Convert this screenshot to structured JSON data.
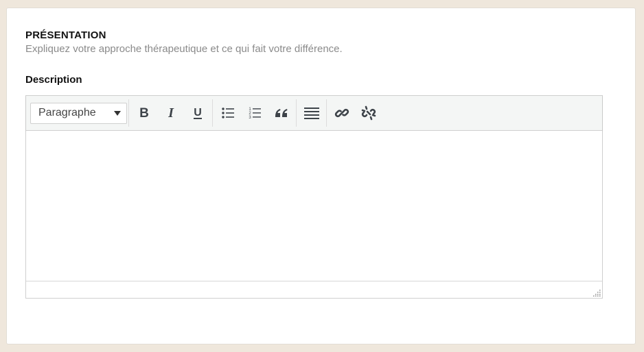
{
  "section": {
    "title": "PRÉSENTATION",
    "subtitle": "Expliquez votre approche thérapeutique et ce qui fait votre différence."
  },
  "field": {
    "label": "Description"
  },
  "editor": {
    "format_select": {
      "selected": "Paragraphe",
      "icon": "chevron-down-icon"
    },
    "toolbar_buttons": [
      {
        "name": "bold-button",
        "icon": "bold-icon"
      },
      {
        "name": "italic-button",
        "icon": "italic-icon"
      },
      {
        "name": "underline-button",
        "icon": "underline-icon"
      },
      {
        "name": "bullet-list-button",
        "icon": "bullet-list-icon"
      },
      {
        "name": "numbered-list-button",
        "icon": "numbered-list-icon"
      },
      {
        "name": "blockquote-button",
        "icon": "quote-icon"
      },
      {
        "name": "justify-button",
        "icon": "align-justify-icon"
      },
      {
        "name": "insert-link-button",
        "icon": "link-icon"
      },
      {
        "name": "remove-link-button",
        "icon": "unlink-icon"
      }
    ],
    "content": ""
  },
  "colors": {
    "page_background": "#efe7dc",
    "card_background": "#ffffff",
    "toolbar_background": "#f4f6f5",
    "icon_color": "#3d4349",
    "subtitle_color": "#8a8a8a"
  }
}
